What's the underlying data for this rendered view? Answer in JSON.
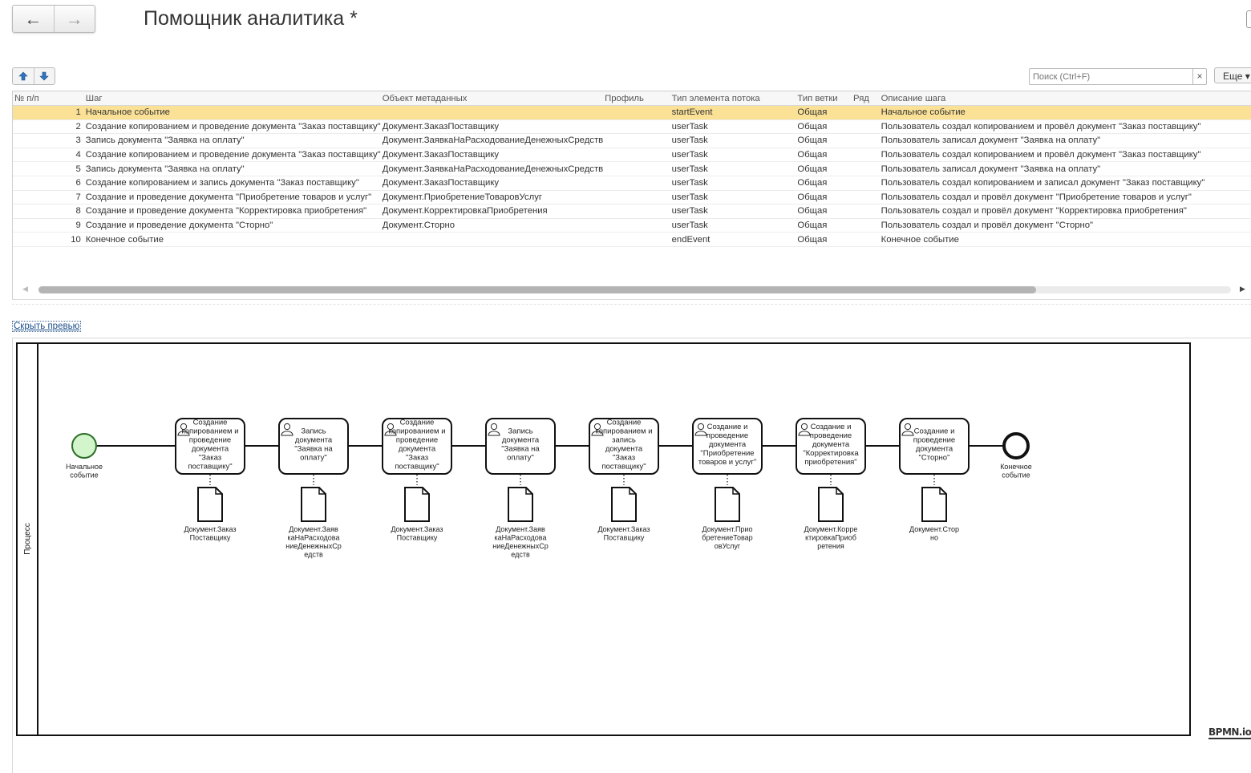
{
  "nav": {
    "back_icon": "arrow-left-icon",
    "forward_icon": "arrow-right-icon"
  },
  "title": "Помощник аналитика *",
  "toolbar": {
    "up_icon": "arrow-up-icon",
    "down_icon": "arrow-down-icon",
    "search_placeholder": "Поиск (Ctrl+F)",
    "search_clear": "×",
    "more_label": "Еще"
  },
  "table": {
    "columns": [
      "№ п/п",
      "Шаг",
      "Объект метаданных",
      "Профиль",
      "Тип элемента потока",
      "Тип ветки",
      "Ряд",
      "Описание шага"
    ],
    "selected_row": 0,
    "rows": [
      [
        "1",
        "Начальное событие",
        "",
        "",
        "startEvent",
        "Общая",
        "",
        "Начальное событие"
      ],
      [
        "2",
        "Создание копированием и проведение документа \"Заказ поставщику\"",
        "Документ.ЗаказПоставщику",
        "",
        "userTask",
        "Общая",
        "",
        "Пользователь создал копированием и провёл документ \"Заказ поставщику\""
      ],
      [
        "3",
        "Запись документа \"Заявка на оплату\"",
        "Документ.ЗаявкаНаРасходованиеДенежныхСредств",
        "",
        "userTask",
        "Общая",
        "",
        "Пользователь записал документ \"Заявка на оплату\""
      ],
      [
        "4",
        "Создание копированием и проведение документа \"Заказ поставщику\"",
        "Документ.ЗаказПоставщику",
        "",
        "userTask",
        "Общая",
        "",
        "Пользователь создал копированием и провёл документ \"Заказ поставщику\""
      ],
      [
        "5",
        "Запись документа \"Заявка на оплату\"",
        "Документ.ЗаявкаНаРасходованиеДенежныхСредств",
        "",
        "userTask",
        "Общая",
        "",
        "Пользователь записал документ \"Заявка на оплату\""
      ],
      [
        "6",
        "Создание копированием и запись документа \"Заказ поставщику\"",
        "Документ.ЗаказПоставщику",
        "",
        "userTask",
        "Общая",
        "",
        "Пользователь создал копированием и записал документ \"Заказ поставщику\""
      ],
      [
        "7",
        "Создание и проведение документа \"Приобретение товаров и услуг\"",
        "Документ.ПриобретениеТоваровУслуг",
        "",
        "userTask",
        "Общая",
        "",
        "Пользователь создал и провёл документ \"Приобретение товаров и услуг\""
      ],
      [
        "8",
        "Создание и проведение документа \"Корректировка приобретения\"",
        "Документ.КорректировкаПриобретения",
        "",
        "userTask",
        "Общая",
        "",
        "Пользователь создал и провёл документ \"Корректировка приобретения\""
      ],
      [
        "9",
        "Создание и проведение документа \"Сторно\"",
        "Документ.Сторно",
        "",
        "userTask",
        "Общая",
        "",
        "Пользователь создал и провёл документ \"Сторно\""
      ],
      [
        "10",
        "Конечное событие",
        "",
        "",
        "endEvent",
        "Общая",
        "",
        "Конечное событие"
      ]
    ]
  },
  "preview": {
    "hide_label": "Скрыть превью",
    "pool_label": "Процесс",
    "start_label": [
      "Начальное",
      "событие"
    ],
    "end_label": [
      "Конечное",
      "событие"
    ],
    "tasks": [
      {
        "text": [
          "Создание",
          "копированием и",
          "проведение",
          "документа",
          "\"Заказ",
          "поставщику\""
        ],
        "doc": [
          "Документ.Заказ",
          "Поставщику"
        ]
      },
      {
        "text": [
          "Запись",
          "документа",
          "\"Заявка на",
          "оплату\""
        ],
        "doc": [
          "Документ.Заяв",
          "каНаРасходова",
          "ниеДенежныхСр",
          "едств"
        ]
      },
      {
        "text": [
          "Создание",
          "копированием и",
          "проведение",
          "документа",
          "\"Заказ",
          "поставщику\""
        ],
        "doc": [
          "Документ.Заказ",
          "Поставщику"
        ]
      },
      {
        "text": [
          "Запись",
          "документа",
          "\"Заявка на",
          "оплату\""
        ],
        "doc": [
          "Документ.Заяв",
          "каНаРасходова",
          "ниеДенежныхСр",
          "едств"
        ]
      },
      {
        "text": [
          "Создание",
          "копированием и",
          "запись",
          "документа",
          "\"Заказ",
          "поставщику\""
        ],
        "doc": [
          "Документ.Заказ",
          "Поставщику"
        ]
      },
      {
        "text": [
          "Создание и",
          "проведение",
          "документа",
          "\"Приобретение",
          "товаров и услуг\""
        ],
        "doc": [
          "Документ.Прио",
          "бретениеТовар",
          "овУслуг"
        ]
      },
      {
        "text": [
          "Создание и",
          "проведение",
          "документа",
          "\"Корректировка",
          "приобретения\""
        ],
        "doc": [
          "Документ.Корре",
          "ктировкаПриоб",
          "ретения"
        ]
      },
      {
        "text": [
          "Создание и",
          "проведение",
          "документа",
          "\"Сторно\""
        ],
        "doc": [
          "Документ.Стор",
          "но"
        ]
      }
    ],
    "logo": "BPMN.io",
    "colors": {
      "start_fill": "#d3f5cc",
      "start_stroke": "#2a6e25",
      "selected_row": "#fbe196"
    }
  }
}
